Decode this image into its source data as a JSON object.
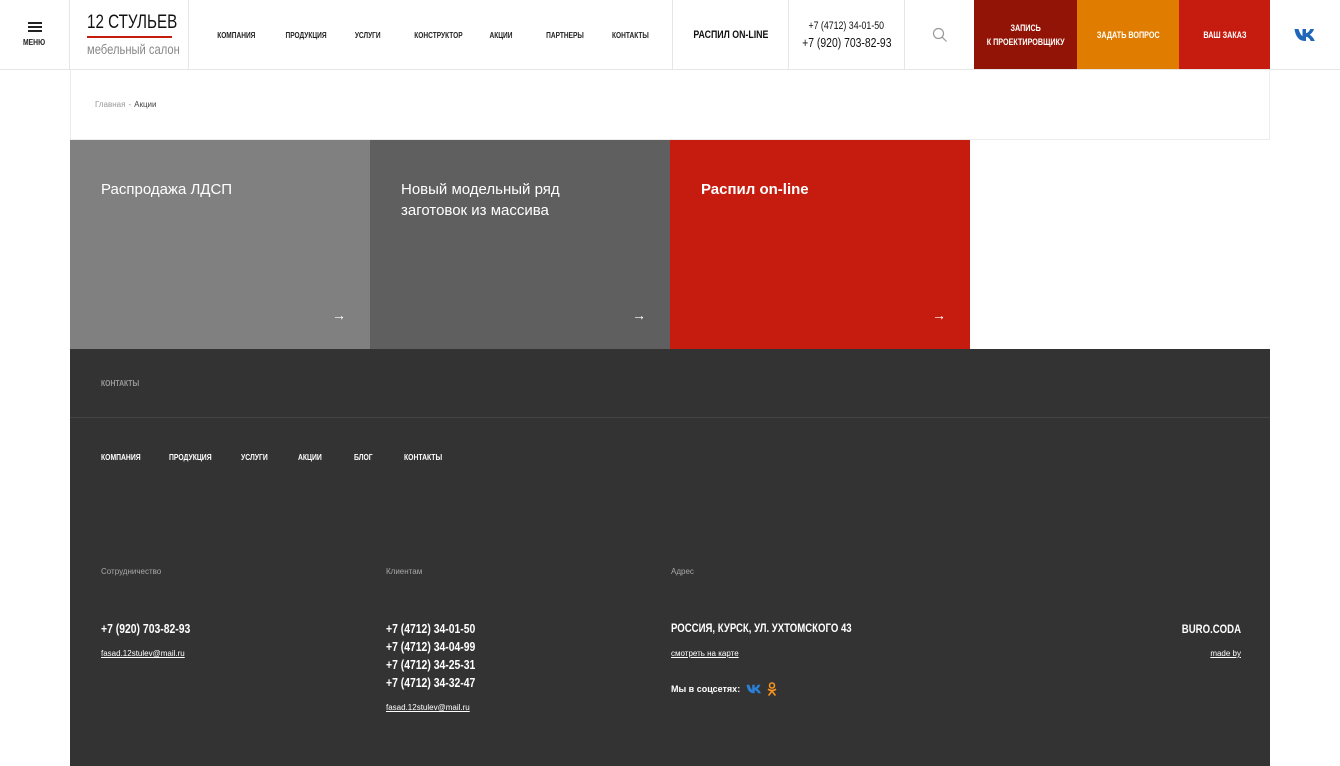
{
  "header": {
    "menu_label": "МЕНЮ",
    "logo_title": "12 СТУЛЬЕВ",
    "logo_subtitle": "мебельный салон",
    "nav": [
      "КОМПАНИЯ",
      "ПРОДУКЦИЯ",
      "УСЛУГИ",
      "КОНСТРУКТОР",
      "АКЦИИ",
      "ПАРТНЕРЫ",
      "КОНТАКТЫ"
    ],
    "raspil": "РАСПИЛ ON-LINE",
    "phone1": "+7 (4712) 34-01-50",
    "phone2": "+7 (920) 703-82-93",
    "btn_zapis": "ЗАПИСЬ\nК ПРОЕКТИРОВЩИКУ",
    "btn_vopros": "ЗАДАТЬ ВОПРОС",
    "btn_zakaz": "ВАШ ЗАКАЗ"
  },
  "breadcrumb": {
    "home": "Главная",
    "sep": "-",
    "current": "Акции"
  },
  "tiles": [
    {
      "title": "Распродажа ЛДСП",
      "arrow": "→"
    },
    {
      "title": "Новый модельный ряд\nзаготовок из массива",
      "arrow": "→"
    },
    {
      "title": "Распил on-line",
      "arrow": "→"
    }
  ],
  "footer": {
    "contacts_heading": "КОНТАКТЫ",
    "nav": [
      "КОМПАНИЯ",
      "ПРОДУКЦИЯ",
      "УСЛУГИ",
      "АКЦИИ",
      "БЛОГ",
      "КОНТАКТЫ"
    ],
    "col1": {
      "heading": "Сотрудничество",
      "phone": "+7 (920) 703-82-93",
      "email": "fasad.12stulev@mail.ru"
    },
    "col2": {
      "heading": "Клиентам",
      "phones": [
        "+7 (4712) 34-01-50",
        "+7 (4712) 34-04-99",
        "+7 (4712) 34-25-31",
        "+7 (4712) 34-32-47"
      ],
      "email": "fasad.12stulev@mail.ru"
    },
    "col3": {
      "heading": "Адрес",
      "address": "РОССИЯ, КУРСК, УЛ. УХТОМСКОГО 43",
      "map_link": "смотреть на карте",
      "social_label": "Мы в соцсетях:"
    },
    "buro": "BURO.CODA",
    "made_by": "made by"
  },
  "colors": {
    "red": "#c61c0f",
    "dark_red": "#921406",
    "orange": "#e07d00",
    "footer_bg": "#333333",
    "vk_blue": "#2a7fd6",
    "ok_orange": "#f7931e"
  },
  "icons": {
    "menu": "menu-icon",
    "search": "search-icon",
    "vk": "vk-icon",
    "ok": "odnoklassniki-icon"
  }
}
